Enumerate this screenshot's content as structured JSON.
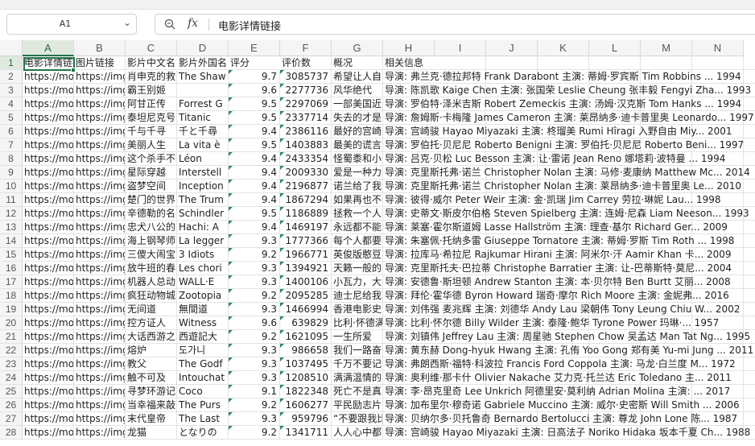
{
  "name_box": {
    "value": "A1"
  },
  "formula_bar": {
    "fx_label": "fx",
    "content": "电影详情链接"
  },
  "columns": [
    "A",
    "B",
    "C",
    "D",
    "E",
    "F",
    "G",
    "H",
    "I",
    "J",
    "K",
    "L",
    "M",
    "N"
  ],
  "rows": [
    {
      "n": "1",
      "a": "电影详情链接",
      "b": "图片链接",
      "c": "影片中文名",
      "d": "影片外国名",
      "e": "评分",
      "f": "评价数",
      "g": "概况",
      "h": "相关信息"
    },
    {
      "n": "2",
      "a": "https://mo",
      "b": "https://img",
      "c": "肖申克的救",
      "d": "The Shaw",
      "e": "9.7",
      "f": "3085737",
      "g": "希望让人自",
      "h": "导演: 弗兰克·德拉邦特 Frank Darabont   主演: 蒂姆·罗宾斯 Tim Robbins   ... 1994"
    },
    {
      "n": "3",
      "a": "https://mo",
      "b": "https://img",
      "c": "霸王别姬",
      "d": "",
      "e": "9.6",
      "f": "2277736",
      "g": "风华绝代",
      "h": "导演: 陈凯歌 Kaige Chen   主演: 张国荣 Leslie Cheung   张丰毅 Fengyi Zha... 1993"
    },
    {
      "n": "4",
      "a": "https://mo",
      "b": "https://img",
      "c": "阿甘正传",
      "d": "Forrest G",
      "e": "9.5",
      "f": "2297069",
      "g": "一部美国近",
      "h": "导演: 罗伯特·泽米吉斯 Robert Zemeckis   主演: 汤姆·汉克斯 Tom Hanks   ... 1994"
    },
    {
      "n": "5",
      "a": "https://mo",
      "b": "https://img",
      "c": "泰坦尼克号",
      "d": "Titanic",
      "e": "9.5",
      "f": "2337714",
      "g": "失去的才是",
      "h": "导演: 詹姆斯·卡梅隆 James Cameron   主演: 莱昂纳多·迪卡普里奥 Leonardo... 1997"
    },
    {
      "n": "6",
      "a": "https://mo",
      "b": "https://img",
      "c": "千与千寻",
      "d": "千と千尋",
      "e": "9.4",
      "f": "2386116",
      "g": "最好的宫崎",
      "h": "导演: 宫崎骏 Hayao Miyazaki   主演: 柊瑠美 Rumi Hîragi   入野自由 Miy... 2001"
    },
    {
      "n": "7",
      "a": "https://mo",
      "b": "https://img",
      "c": "美丽人生",
      "d": "La vita è",
      "e": "9.5",
      "f": "1403883",
      "g": "最美的谎言",
      "h": "导演: 罗伯托·贝尼尼 Roberto Benigni   主演: 罗伯托·贝尼尼 Roberto Beni... 1997"
    },
    {
      "n": "8",
      "a": "https://mo",
      "b": "https://img",
      "c": "这个杀手不",
      "d": "Léon",
      "e": "9.4",
      "f": "2433354",
      "g": "怪蜀黍和小",
      "h": "导演: 吕克·贝松 Luc Besson   主演: 让·雷诺 Jean Reno   娜塔莉·波特曼 ... 1994"
    },
    {
      "n": "9",
      "a": "https://mo",
      "b": "https://img",
      "c": "星际穿越",
      "d": "Interstell",
      "e": "9.4",
      "f": "2009330",
      "g": "爱是一种力",
      "h": "导演: 克里斯托弗·诺兰 Christopher Nolan   主演: 马修·麦康纳 Matthew Mc... 2014"
    },
    {
      "n": "10",
      "a": "https://mo",
      "b": "https://img",
      "c": "盗梦空间",
      "d": "Inception",
      "e": "9.4",
      "f": "2196877",
      "g": "诺兰给了我",
      "h": "导演: 克里斯托弗·诺兰 Christopher Nolan   主演: 莱昂纳多·迪卡普里奥 Le... 2010"
    },
    {
      "n": "11",
      "a": "https://mo",
      "b": "https://img",
      "c": "楚门的世界",
      "d": "The Trum",
      "e": "9.4",
      "f": "1867294",
      "g": "如果再也不",
      "h": "导演: 彼得·威尔 Peter Weir   主演: 金·凯瑞 Jim Carrey   劳拉·琳妮 Lau... 1998"
    },
    {
      "n": "12",
      "a": "https://mo",
      "b": "https://img",
      "c": "辛德勒的名",
      "d": "Schindler",
      "e": "9.5",
      "f": "1186889",
      "g": "拯救一个人",
      "h": "导演: 史蒂文·斯皮尔伯格 Steven Spielberg   主演: 连姆·尼森 Liam Neeson... 1993"
    },
    {
      "n": "13",
      "a": "https://mo",
      "b": "https://img",
      "c": "忠犬八公的",
      "d": "Hachi: A",
      "e": "9.4",
      "f": "1469197",
      "g": "永远都不能",
      "h": "导演: 莱塞·霍尔斯道姆 Lasse Hallström   主演: 理查·基尔 Richard Ger... 2009"
    },
    {
      "n": "14",
      "a": "https://mo",
      "b": "https://img",
      "c": "海上钢琴师",
      "d": "La legger",
      "e": "9.3",
      "f": "1777366",
      "g": "每个人都要",
      "h": "导演: 朱塞佩·托纳多雷 Giuseppe Tornatore   主演: 蒂姆·罗斯 Tim Roth   ... 1998"
    },
    {
      "n": "15",
      "a": "https://mo",
      "b": "https://img",
      "c": "三傻大闹宝",
      "d": "3 Idiots",
      "e": "9.2",
      "f": "1966771",
      "g": "英俊版憨豆",
      "h": "导演: 拉库马·希拉尼 Rajkumar Hirani   主演: 阿米尔·汗 Aamir Khan   卡... 2009"
    },
    {
      "n": "16",
      "a": "https://mo",
      "b": "https://img",
      "c": "放牛班的春",
      "d": "Les chori",
      "e": "9.3",
      "f": "1394921",
      "g": "天籁一般的",
      "h": "导演: 克里斯托夫·巴拉蒂 Christophe Barratier   主演: 让-巴蒂斯特·莫尼... 2004"
    },
    {
      "n": "17",
      "a": "https://mo",
      "b": "https://img",
      "c": "机器人总动",
      "d": "WALL·E",
      "e": "9.3",
      "f": "1400106",
      "g": "小瓦力，大",
      "h": "导演: 安德鲁·斯坦顿 Andrew Stanton   主演: 本·贝尔特 Ben Burtt   艾丽... 2008"
    },
    {
      "n": "18",
      "a": "https://mo",
      "b": "https://img",
      "c": "疯狂动物城",
      "d": "Zootopia",
      "e": "9.2",
      "f": "2095285",
      "g": "迪士尼给我",
      "h": "导演: 拜伦·霍华德 Byron Howard   瑞奇·摩尔 Rich Moore   主演: 金妮弗... 2016"
    },
    {
      "n": "19",
      "a": "https://mo",
      "b": "https://img",
      "c": "无间道",
      "d": "無間道",
      "e": "9.3",
      "f": "1466994",
      "g": "香港电影史",
      "h": "导演: 刘伟强   麦兆辉   主演: 刘德华 Andy Lau   梁朝伟 Tony Leung Chiu W... 2002"
    },
    {
      "n": "20",
      "a": "https://mo",
      "b": "https://img",
      "c": "控方证人",
      "d": "Witness",
      "e": "9.6",
      "f": "639829",
      "g": "比利·怀德满",
      "h": "导演: 比利·怀尔德 Billy Wilder   主演: 泰隆·鲍华 Tyrone Power   玛琳·... 1957"
    },
    {
      "n": "21",
      "a": "https://mo",
      "b": "https://img",
      "c": "大话西游之",
      "d": "西遊記大",
      "e": "9.2",
      "f": "1621095",
      "g": "一生所爱",
      "h": "导演: 刘镇伟 Jeffrey Lau   主演: 周星驰 Stephen Chow   吴孟达 Man Tat Ng... 1995"
    },
    {
      "n": "22",
      "a": "https://mo",
      "b": "https://img",
      "c": "熔炉",
      "d": "도가니",
      "e": "9.3",
      "f": "986658",
      "g": "我们一路奋",
      "h": "导演: 黄东赫 Dong-hyuk Hwang   主演: 孔侑 Yoo Gong   郑有美 Yu-mi Jung ... 2011"
    },
    {
      "n": "23",
      "a": "https://mo",
      "b": "https://img",
      "c": "教父",
      "d": "The Godf",
      "e": "9.3",
      "f": "1037495",
      "g": "千万不要记",
      "h": "导演: 弗朗西斯·福特·科波拉 Francis Ford Coppola   主演: 马龙·白兰度 M... 1972"
    },
    {
      "n": "24",
      "a": "https://mo",
      "b": "https://img",
      "c": "触不可及",
      "d": "Intouchat",
      "e": "9.3",
      "f": "1208510",
      "g": "满满温情的",
      "h": "导演: 奥利维·那卡什 Olivier Nakache   艾力克·托兰达 Eric Toledano   主... 2011"
    },
    {
      "n": "25",
      "a": "https://mo",
      "b": "https://img",
      "c": "寻梦环游记",
      "d": "Coco",
      "e": "9.1",
      "f": "1822348",
      "g": "死亡不是真",
      "h": "导演: 李·昂克里奇 Lee Unkrich   阿德里安·莫利纳 Adrian Molina   主演: ... 2017"
    },
    {
      "n": "26",
      "a": "https://mo",
      "b": "https://img",
      "c": "当幸福来敲",
      "d": "The Purs",
      "e": "9.2",
      "f": "1606277",
      "g": "平民励志片",
      "h": "导演: 加布里尔·穆奇诺 Gabriele Muccino   主演: 威尔·史密斯 Will Smith ... 2006"
    },
    {
      "n": "27",
      "a": "https://mo",
      "b": "https://img",
      "c": "末代皇帝",
      "d": "The Last",
      "e": "9.3",
      "f": "959796",
      "g": "“不要跟我比",
      "h": "导演: 贝纳尔多·贝托鲁奇 Bernardo Bertolucci   主演: 尊龙 John Lone   陈... 1987"
    },
    {
      "n": "28",
      "a": "https://mo",
      "b": "https://img",
      "c": "龙猫",
      "d": "となりの",
      "e": "9.2",
      "f": "1341711",
      "g": "人人心中都",
      "h": "导演: 宫崎骏 Hayao Miyazaki   主演: 日高法子 Noriko Hidaka   坂本千夏 Ch... 1988"
    }
  ]
}
